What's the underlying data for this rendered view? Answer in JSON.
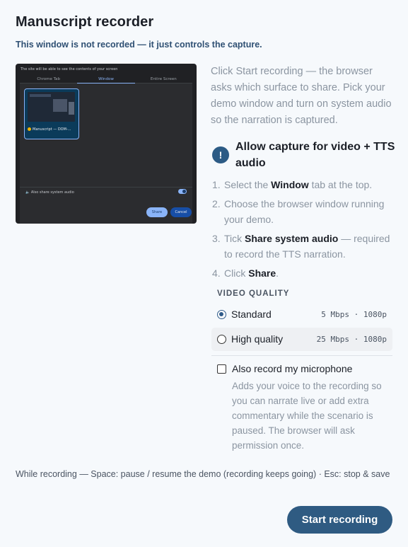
{
  "header": {
    "title": "Manuscript recorder",
    "subtitle": "This window is not recorded — it just controls the capture."
  },
  "preview": {
    "heading": "The site will be able to see the contents of your screen",
    "tabs": [
      "Chrome Tab",
      "Window",
      "Entire Screen"
    ],
    "active_tab": "Window",
    "thumbnail_label": "Manuscript — DOM-...",
    "audio_label": "Also share system audio",
    "share_label": "Share",
    "cancel_label": "Cancel"
  },
  "intro": "Click Start recording — the browser asks which surface to share. Pick your demo window and turn on system audio so the narration is captured.",
  "alert": {
    "icon": "exclamation-icon",
    "title": "Allow capture for video + TTS audio"
  },
  "steps": [
    {
      "num": "1.",
      "pre": "Select the ",
      "bold": "Window",
      "post": " tab at the top."
    },
    {
      "num": "2.",
      "pre": "Choose the browser window running your demo.",
      "bold": "",
      "post": ""
    },
    {
      "num": "3.",
      "pre": "Tick ",
      "bold": "Share system audio",
      "post": " — required to record the TTS narration."
    },
    {
      "num": "4.",
      "pre": "Click ",
      "bold": "Share",
      "post": "."
    }
  ],
  "quality": {
    "label": "VIDEO QUALITY",
    "options": [
      {
        "label": "Standard",
        "spec": "5 Mbps · 1080p",
        "selected": true
      },
      {
        "label": "High quality",
        "spec": "25 Mbps · 1080p",
        "selected": false
      }
    ]
  },
  "microphone": {
    "label": "Also record my microphone",
    "checked": false,
    "description": "Adds your voice to the recording so you can narrate live or add extra commentary while the scenario is paused. The browser will ask permission once."
  },
  "hint": "While recording — Space: pause / resume the demo (recording keeps going) · Esc: stop & save",
  "start_label": "Start recording",
  "colors": {
    "accent": "#2f5b82",
    "background": "#f6f9fc"
  }
}
